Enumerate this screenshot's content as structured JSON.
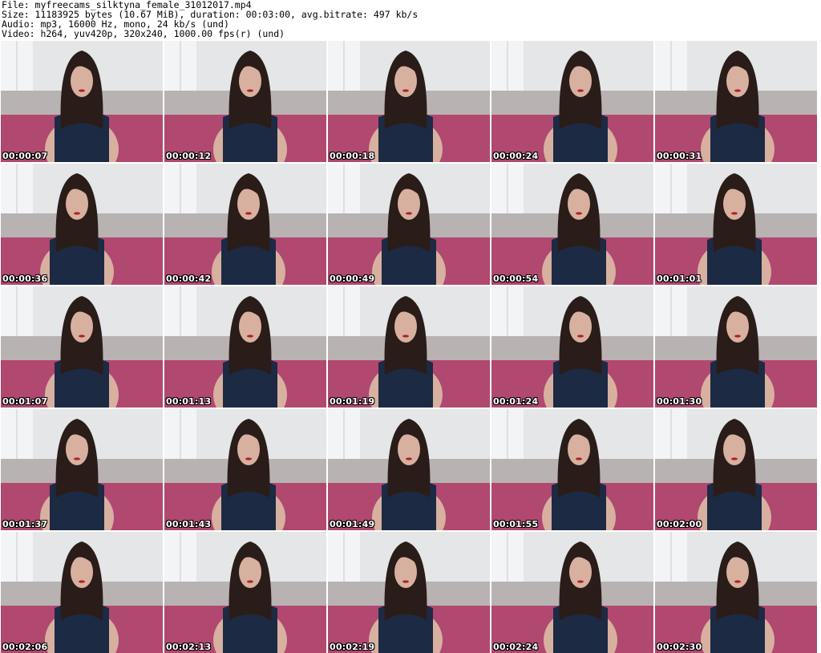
{
  "header": {
    "line1": "File: myfreecams_silktyna_female_31012017.mp4",
    "line2": "Size: 11183925 bytes (10.67 MiB), duration: 00:03:00, avg.bitrate: 497 kb/s",
    "line3": "Audio: mp3, 16000 Hz, mono, 24 kb/s (und)",
    "line4": "Video: h264, yuv420p, 320x240, 1000.00 fps(r) (und)"
  },
  "frames": [
    {
      "time": "00:00:07"
    },
    {
      "time": "00:00:12"
    },
    {
      "time": "00:00:18"
    },
    {
      "time": "00:00:24"
    },
    {
      "time": "00:00:31"
    },
    {
      "time": "00:00:36"
    },
    {
      "time": "00:00:42"
    },
    {
      "time": "00:00:49"
    },
    {
      "time": "00:00:54"
    },
    {
      "time": "00:01:01"
    },
    {
      "time": "00:01:07"
    },
    {
      "time": "00:01:13"
    },
    {
      "time": "00:01:19"
    },
    {
      "time": "00:01:24"
    },
    {
      "time": "00:01:30"
    },
    {
      "time": "00:01:37"
    },
    {
      "time": "00:01:43"
    },
    {
      "time": "00:01:49"
    },
    {
      "time": "00:01:55"
    },
    {
      "time": "00:02:00"
    },
    {
      "time": "00:02:06"
    },
    {
      "time": "00:02:13"
    },
    {
      "time": "00:02:19"
    },
    {
      "time": "00:02:24"
    },
    {
      "time": "00:02:30"
    }
  ],
  "colors": {
    "wall": "#e4e6e8",
    "sofa": "#b9b2b2",
    "floor": "#b04870",
    "hair": "#2a1c18",
    "skin": "#d8b0a0",
    "top": "#1c2a44"
  }
}
